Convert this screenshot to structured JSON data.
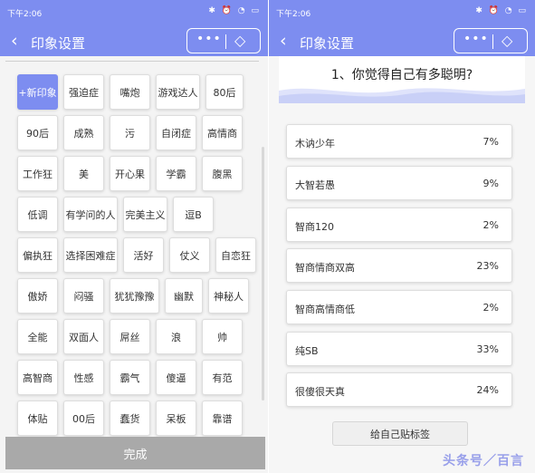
{
  "screens": [
    {
      "status_time": "下午2:06",
      "title": "印象设置",
      "tags_rows": [
        [
          {
            "label": "+新印象",
            "w": 45,
            "new": true
          },
          {
            "label": "强迫症",
            "w": 45
          },
          {
            "label": "嘴炮",
            "w": 45
          },
          {
            "label": "游戏达人",
            "w": 49
          },
          {
            "label": "80后",
            "w": 42
          }
        ],
        [
          {
            "label": "90后",
            "w": 45
          },
          {
            "label": "成熟",
            "w": 45
          },
          {
            "label": "污",
            "w": 45
          },
          {
            "label": "自闭症",
            "w": 45
          },
          {
            "label": "高情商",
            "w": 45
          }
        ],
        [
          {
            "label": "工作狂",
            "w": 45
          },
          {
            "label": "美",
            "w": 45
          },
          {
            "label": "开心果",
            "w": 45
          },
          {
            "label": "学霸",
            "w": 45
          },
          {
            "label": "腹黑",
            "w": 45
          }
        ],
        [
          {
            "label": "低调",
            "w": 45
          },
          {
            "label": "有学问的人",
            "w": 60
          },
          {
            "label": "完美主义",
            "w": 49
          },
          {
            "label": "逗B",
            "w": 45
          }
        ],
        [
          {
            "label": "偏执狂",
            "w": 45
          },
          {
            "label": "选择困难症",
            "w": 60
          },
          {
            "label": "活好",
            "w": 45
          },
          {
            "label": "仗义",
            "w": 45
          },
          {
            "label": "自恋狂",
            "w": 45
          }
        ],
        [
          {
            "label": "傲娇",
            "w": 45
          },
          {
            "label": "闷骚",
            "w": 45
          },
          {
            "label": "犹犹豫豫",
            "w": 55
          },
          {
            "label": "幽默",
            "w": 42
          },
          {
            "label": "神秘人",
            "w": 45
          }
        ],
        [
          {
            "label": "全能",
            "w": 45
          },
          {
            "label": "双面人",
            "w": 45
          },
          {
            "label": "屌丝",
            "w": 45
          },
          {
            "label": "浪",
            "w": 45
          },
          {
            "label": "帅",
            "w": 45
          }
        ],
        [
          {
            "label": "高智商",
            "w": 45
          },
          {
            "label": "性感",
            "w": 45
          },
          {
            "label": "霸气",
            "w": 45
          },
          {
            "label": "傻逼",
            "w": 45
          },
          {
            "label": "有范",
            "w": 45
          }
        ],
        [
          {
            "label": "体贴",
            "w": 45
          },
          {
            "label": "00后",
            "w": 45
          },
          {
            "label": "蠢货",
            "w": 45
          },
          {
            "label": "呆板",
            "w": 45
          },
          {
            "label": "靠谱",
            "w": 45
          }
        ]
      ],
      "done_label": "完成"
    },
    {
      "status_time": "下午2:06",
      "title": "印象设置",
      "question": "1、你觉得自己有多聪明?",
      "options": [
        {
          "label": "木讷少年",
          "pct": "7%"
        },
        {
          "label": "大智若愚",
          "pct": "9%"
        },
        {
          "label": "智商120",
          "pct": "2%"
        },
        {
          "label": "智商情商双高",
          "pct": "23%"
        },
        {
          "label": "智商高情商低",
          "pct": "2%"
        },
        {
          "label": "纯SB",
          "pct": "33%"
        },
        {
          "label": "很傻很天真",
          "pct": "24%"
        }
      ],
      "cta_label": "给自己贴标签",
      "watermark": "头条号／百言"
    }
  ],
  "status_icons": "✱ ⏰ ◔ ▭",
  "menu_dots": "•••",
  "icons": {
    "back": "chevron-left-icon",
    "more": "more-dots-icon",
    "target": "target-icon"
  },
  "colors": {
    "primary": "#7d8df0",
    "done_bg": "#a9a9a9"
  }
}
